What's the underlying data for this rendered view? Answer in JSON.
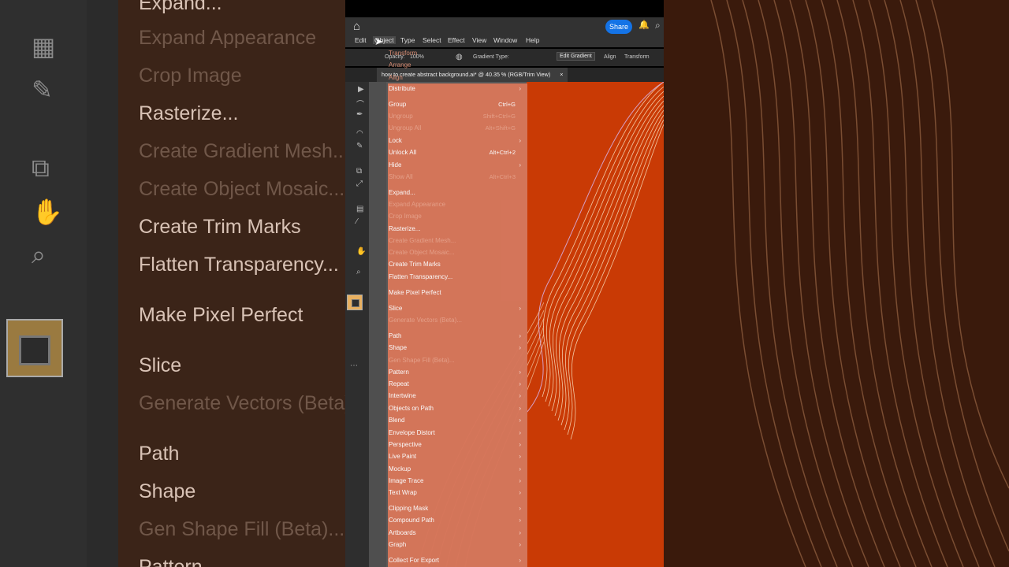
{
  "side_menu_bg": {
    "items": [
      "Expand...",
      "Expand Appearance",
      "Crop Image",
      "Rasterize...",
      "Create Gradient Mesh...",
      "Create Object Mosaic...",
      "Create Trim Marks",
      "Flatten Transparency...",
      "Make Pixel Perfect",
      "Slice",
      "Generate Vectors (Beta)...",
      "Path",
      "Shape",
      "Gen Shape Fill (Beta)...",
      "Pattern"
    ]
  },
  "titlebar": {
    "share_label": "Share"
  },
  "menubar": {
    "items": [
      "Edit",
      "Object",
      "Type",
      "Select",
      "Effect",
      "View",
      "Window",
      "Help"
    ]
  },
  "ctrlbar": {
    "opacity_label": "Opacity:",
    "opacity_value": "100%",
    "gradient_type_label": "Gradient Type:",
    "edit_gradient": "Edit Gradient",
    "align": "Align",
    "transform": "Transform"
  },
  "document_tab": {
    "title": "how to create abstract background.ai* @ 40.35 % (RGB/Trim View)",
    "close": "×"
  },
  "ghost_top_items": [
    "Transform",
    "Arrange",
    "Align"
  ],
  "object_menu": [
    {
      "label": "Distribute",
      "shortcut": "",
      "arrow": true,
      "disabled": false
    },
    {
      "label": "Group",
      "shortcut": "Ctrl+G",
      "arrow": false,
      "disabled": false
    },
    {
      "label": "Ungroup",
      "shortcut": "Shift+Ctrl+G",
      "arrow": false,
      "disabled": true
    },
    {
      "label": "Ungroup All",
      "shortcut": "Alt+Shift+G",
      "arrow": false,
      "disabled": true
    },
    {
      "label": "Lock",
      "shortcut": "",
      "arrow": true,
      "disabled": false
    },
    {
      "label": "Unlock All",
      "shortcut": "Alt+Ctrl+2",
      "arrow": false,
      "disabled": false
    },
    {
      "label": "Hide",
      "shortcut": "",
      "arrow": true,
      "disabled": false
    },
    {
      "label": "Show All",
      "shortcut": "Alt+Ctrl+3",
      "arrow": false,
      "disabled": true
    },
    {
      "label": "Expand...",
      "shortcut": "",
      "arrow": false,
      "disabled": false
    },
    {
      "label": "Expand Appearance",
      "shortcut": "",
      "arrow": false,
      "disabled": true
    },
    {
      "label": "Crop Image",
      "shortcut": "",
      "arrow": false,
      "disabled": true
    },
    {
      "label": "Rasterize...",
      "shortcut": "",
      "arrow": false,
      "disabled": false
    },
    {
      "label": "Create Gradient Mesh...",
      "shortcut": "",
      "arrow": false,
      "disabled": true
    },
    {
      "label": "Create Object Mosaic...",
      "shortcut": "",
      "arrow": false,
      "disabled": true
    },
    {
      "label": "Create Trim Marks",
      "shortcut": "",
      "arrow": false,
      "disabled": false
    },
    {
      "label": "Flatten Transparency...",
      "shortcut": "",
      "arrow": false,
      "disabled": false
    },
    {
      "label": "Make Pixel Perfect",
      "shortcut": "",
      "arrow": false,
      "disabled": false
    },
    {
      "label": "Slice",
      "shortcut": "",
      "arrow": true,
      "disabled": false
    },
    {
      "label": "Generate Vectors (Beta)...",
      "shortcut": "",
      "arrow": false,
      "disabled": true
    },
    {
      "label": "Path",
      "shortcut": "",
      "arrow": true,
      "disabled": false
    },
    {
      "label": "Shape",
      "shortcut": "",
      "arrow": true,
      "disabled": false
    },
    {
      "label": "Gen Shape Fill (Beta)...",
      "shortcut": "",
      "arrow": false,
      "disabled": true
    },
    {
      "label": "Pattern",
      "shortcut": "",
      "arrow": true,
      "disabled": false
    },
    {
      "label": "Repeat",
      "shortcut": "",
      "arrow": true,
      "disabled": false
    },
    {
      "label": "Intertwine",
      "shortcut": "",
      "arrow": true,
      "disabled": false
    },
    {
      "label": "Objects on Path",
      "shortcut": "",
      "arrow": true,
      "disabled": false
    },
    {
      "label": "Blend",
      "shortcut": "",
      "arrow": true,
      "disabled": false
    },
    {
      "label": "Envelope Distort",
      "shortcut": "",
      "arrow": true,
      "disabled": false
    },
    {
      "label": "Perspective",
      "shortcut": "",
      "arrow": true,
      "disabled": false
    },
    {
      "label": "Live Paint",
      "shortcut": "",
      "arrow": true,
      "disabled": false
    },
    {
      "label": "Mockup",
      "shortcut": "",
      "arrow": true,
      "disabled": false
    },
    {
      "label": "Image Trace",
      "shortcut": "",
      "arrow": true,
      "disabled": false
    },
    {
      "label": "Text Wrap",
      "shortcut": "",
      "arrow": true,
      "disabled": false
    },
    {
      "label": "Clipping Mask",
      "shortcut": "",
      "arrow": true,
      "disabled": false
    },
    {
      "label": "Compound Path",
      "shortcut": "",
      "arrow": true,
      "disabled": false
    },
    {
      "label": "Artboards",
      "shortcut": "",
      "arrow": true,
      "disabled": false
    },
    {
      "label": "Graph",
      "shortcut": "",
      "arrow": true,
      "disabled": false
    },
    {
      "label": "Collect For Export",
      "shortcut": "",
      "arrow": true,
      "disabled": false
    }
  ],
  "colors": {
    "artboard": "#c93a05",
    "menu": "#d8765a",
    "accent": "#1473e6"
  }
}
